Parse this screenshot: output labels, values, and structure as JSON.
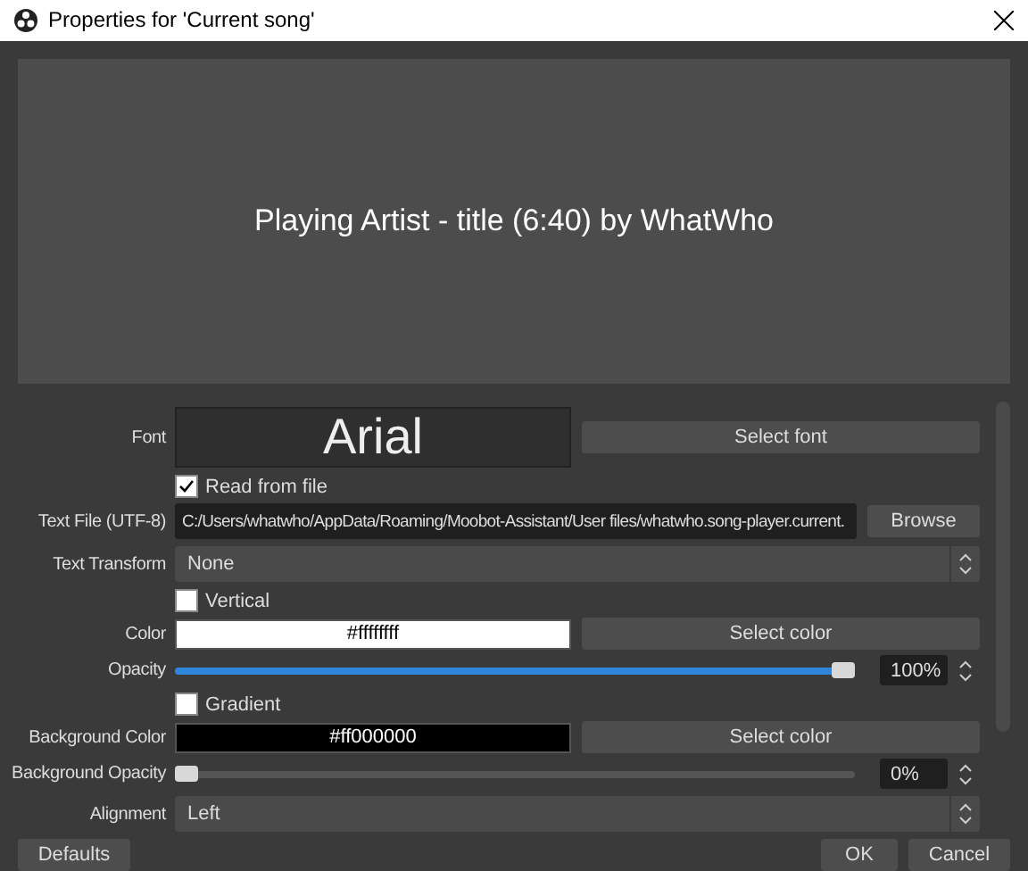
{
  "window": {
    "title": "Properties for 'Current song'"
  },
  "preview": {
    "text": "Playing Artist - title (6:40) by WhatWho"
  },
  "rows": [
    {
      "kind": "font",
      "label": "Font",
      "value": "Arial",
      "button": "Select font"
    },
    {
      "kind": "checkbox",
      "label": "Read from file",
      "checked": true
    },
    {
      "kind": "file",
      "label": "Text File (UTF-8)",
      "value": "C:/Users/whatwho/AppData/Roaming/Moobot-Assistant/User files/whatwho.song-player.current.",
      "button": "Browse"
    },
    {
      "kind": "select",
      "label": "Text Transform",
      "value": "None"
    },
    {
      "kind": "checkbox",
      "label": "Vertical",
      "checked": false
    },
    {
      "kind": "color",
      "label": "Color",
      "value": "#ffffffff",
      "color": "#ffffff",
      "button": "Select color"
    },
    {
      "kind": "slider",
      "label": "Opacity",
      "level": 1,
      "reading": "100%"
    },
    {
      "kind": "checkbox",
      "label": "Gradient",
      "checked": false
    },
    {
      "kind": "color",
      "label": "Background Color",
      "value": "#ff000000",
      "color": "#000000",
      "button": "Select color"
    },
    {
      "kind": "slider",
      "label": "Background Opacity",
      "level": 0,
      "reading": "0%"
    },
    {
      "kind": "select",
      "label": "Alignment",
      "value": "Left"
    }
  ],
  "buttons": {
    "defaults": "Defaults",
    "ok": "OK",
    "cancel": "Cancel"
  }
}
